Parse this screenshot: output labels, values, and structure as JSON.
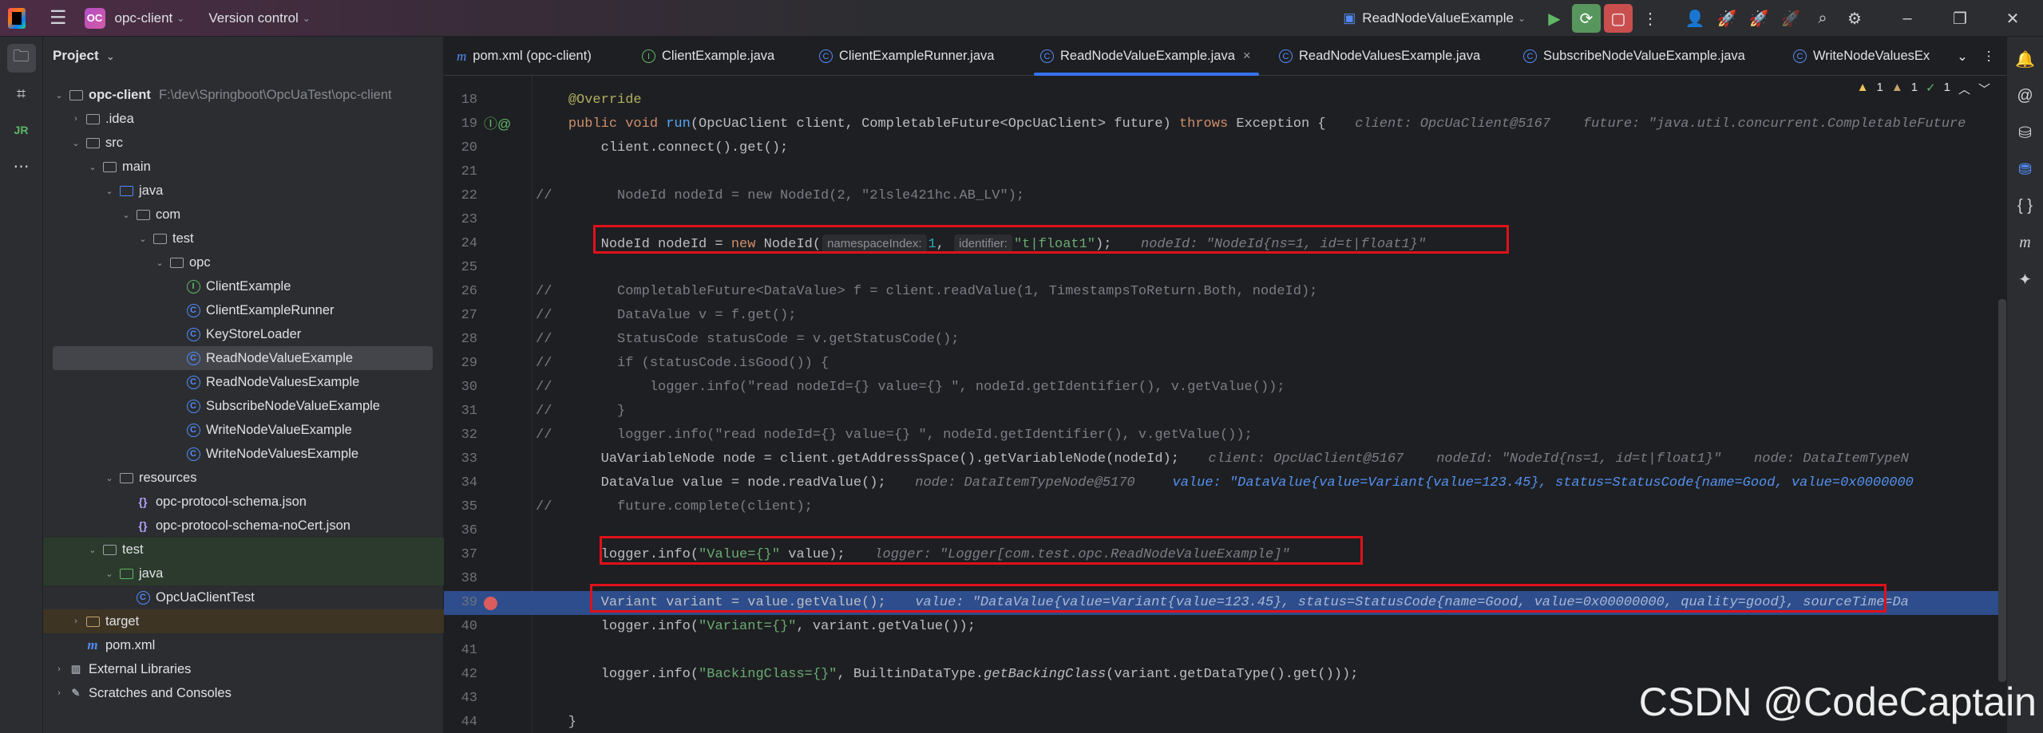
{
  "titlebar": {
    "project_badge": "OC",
    "project_name": "opc-client",
    "vcs_label": "Version control",
    "run_config": "ReadNodeValueExample"
  },
  "colors": {
    "accent": "#3574f0",
    "run_green": "#57965c",
    "stop_red": "#c94f4f",
    "highlight_line": "#2d4d8c",
    "annotation_box": "#e0111a"
  },
  "project_panel": {
    "title": "Project",
    "tree": [
      {
        "label": "opc-client",
        "path": "F:\\dev\\Springboot\\OpcUaTest\\opc-client",
        "level": 0,
        "icon": "module-folder",
        "expanded": true,
        "bold": true
      },
      {
        "label": ".idea",
        "level": 1,
        "icon": "folder",
        "expanded": false
      },
      {
        "label": "src",
        "level": 1,
        "icon": "folder",
        "expanded": true
      },
      {
        "label": "main",
        "level": 2,
        "icon": "folder",
        "expanded": true
      },
      {
        "label": "java",
        "level": 3,
        "icon": "source-folder",
        "expanded": true
      },
      {
        "label": "com",
        "level": 4,
        "icon": "package",
        "expanded": true
      },
      {
        "label": "test",
        "level": 5,
        "icon": "package",
        "expanded": true
      },
      {
        "label": "opc",
        "level": 6,
        "icon": "package",
        "expanded": true
      },
      {
        "label": "ClientExample",
        "level": 7,
        "icon": "interface"
      },
      {
        "label": "ClientExampleRunner",
        "level": 7,
        "icon": "class"
      },
      {
        "label": "KeyStoreLoader",
        "level": 7,
        "icon": "class"
      },
      {
        "label": "ReadNodeValueExample",
        "level": 7,
        "icon": "class",
        "selected": true
      },
      {
        "label": "ReadNodeValuesExample",
        "level": 7,
        "icon": "class"
      },
      {
        "label": "SubscribeNodeValueExample",
        "level": 7,
        "icon": "class"
      },
      {
        "label": "WriteNodeValueExample",
        "level": 7,
        "icon": "class"
      },
      {
        "label": "WriteNodeValuesExample",
        "level": 7,
        "icon": "class"
      },
      {
        "label": "resources",
        "level": 3,
        "icon": "resources-folder",
        "expanded": true
      },
      {
        "label": "opc-protocol-schema.json",
        "level": 4,
        "icon": "json"
      },
      {
        "label": "opc-protocol-schema-noCert.json",
        "level": 4,
        "icon": "json"
      },
      {
        "label": "test",
        "level": 2,
        "icon": "folder",
        "expanded": true,
        "tint": "green"
      },
      {
        "label": "java",
        "level": 3,
        "icon": "test-folder",
        "expanded": true,
        "tint": "green"
      },
      {
        "label": "OpcUaClientTest",
        "level": 4,
        "icon": "class"
      },
      {
        "label": "target",
        "level": 1,
        "icon": "excluded-folder",
        "expanded": false,
        "tint": "brown"
      },
      {
        "label": "pom.xml",
        "level": 1,
        "icon": "maven"
      },
      {
        "label": "External Libraries",
        "level": 0,
        "icon": "libraries",
        "expanded": false
      },
      {
        "label": "Scratches and Consoles",
        "level": 0,
        "icon": "scratches",
        "expanded": false
      }
    ]
  },
  "tabs": [
    {
      "label": "pom.xml (opc-client)",
      "icon": "maven"
    },
    {
      "label": "ClientExample.java",
      "icon": "interface"
    },
    {
      "label": "ClientExampleRunner.java",
      "icon": "class"
    },
    {
      "label": "ReadNodeValueExample.java",
      "icon": "class",
      "active": true
    },
    {
      "label": "ReadNodeValuesExample.java",
      "icon": "class"
    },
    {
      "label": "SubscribeNodeValueExample.java",
      "icon": "class"
    },
    {
      "label": "WriteNodeValuesEx",
      "icon": "class"
    }
  ],
  "inspections": {
    "warnings": "1",
    "weak_warnings": "1",
    "ok": "1"
  },
  "code": [
    {
      "n": "18",
      "t": [
        [
          "    ",
          ""
        ],
        [
          "@Override",
          "ann"
        ]
      ]
    },
    {
      "n": "19",
      "t": [
        [
          "    ",
          ""
        ],
        [
          "public void ",
          "kw"
        ],
        [
          "run",
          "fn"
        ],
        [
          "(OpcUaClient client, CompletableFuture<OpcUaClient> future) ",
          ""
        ],
        [
          "throws ",
          "kw"
        ],
        [
          "Exception {",
          ""
        ],
        [
          "   client: OpcUaClient@5167    future: \"java.util.concurrent.CompletableFuture",
          "hint"
        ]
      ]
    },
    {
      "n": "20",
      "t": [
        [
          "        client.connect().get();",
          ""
        ]
      ]
    },
    {
      "n": "21",
      "t": []
    },
    {
      "n": "22",
      "t": [
        [
          "//        NodeId nodeId = new NodeId(2, \"2lsle421hc.AB_LV\");",
          "cm"
        ]
      ]
    },
    {
      "n": "23",
      "t": []
    },
    {
      "n": "24",
      "t": [
        [
          "        NodeId nodeId = ",
          ""
        ],
        [
          "new ",
          "kw"
        ],
        [
          "NodeId(",
          ""
        ],
        [
          "namespaceIndex:",
          "ph"
        ],
        [
          "1",
          "num"
        ],
        [
          ", ",
          ""
        ],
        [
          "identifier:",
          "ph"
        ],
        [
          "\"t|float1\"",
          "str"
        ],
        [
          ");",
          ""
        ],
        [
          "   nodeId: \"NodeId{ns=1, id=t|float1}\"",
          "hint"
        ]
      ]
    },
    {
      "n": "25",
      "t": []
    },
    {
      "n": "26",
      "t": [
        [
          "//        CompletableFuture<DataValue> f = client.readValue(1, TimestampsToReturn.Both, nodeId);",
          "cm"
        ]
      ]
    },
    {
      "n": "27",
      "t": [
        [
          "//        DataValue v = f.get();",
          "cm"
        ]
      ]
    },
    {
      "n": "28",
      "t": [
        [
          "//        StatusCode statusCode = v.getStatusCode();",
          "cm"
        ]
      ]
    },
    {
      "n": "29",
      "t": [
        [
          "//        if (statusCode.isGood()) {",
          "cm"
        ]
      ]
    },
    {
      "n": "30",
      "t": [
        [
          "//            logger.info(\"read nodeId={} value={} \", nodeId.getIdentifier(), v.getValue());",
          "cm"
        ]
      ]
    },
    {
      "n": "31",
      "t": [
        [
          "//        }",
          "cm"
        ]
      ]
    },
    {
      "n": "32",
      "t": [
        [
          "//        logger.info(\"read nodeId={} value={} \", nodeId.getIdentifier(), v.getValue());",
          "cm"
        ]
      ]
    },
    {
      "n": "33",
      "t": [
        [
          "        UaVariableNode node = client.getAddressSpace().getVariableNode(nodeId);",
          ""
        ],
        [
          "   client: OpcUaClient@5167    nodeId: \"NodeId{ns=1, id=t|float1}\"    node: DataItemTypeN",
          "hint"
        ]
      ]
    },
    {
      "n": "34",
      "t": [
        [
          "        DataValue value = node.readValue();",
          ""
        ],
        [
          "   node: DataItemTypeNode@5170    ",
          "hint"
        ],
        [
          "value: \"DataValue{value=Variant{value=123.45}, status=StatusCode{name=Good, value=0x0000000",
          "dval"
        ]
      ]
    },
    {
      "n": "35",
      "t": [
        [
          "//        future.complete(client);",
          "cm"
        ]
      ]
    },
    {
      "n": "36",
      "t": []
    },
    {
      "n": "37",
      "t": [
        [
          "        logger",
          ""
        ],
        [
          ".info(\"Value={}\", value);",
          "mix37"
        ],
        [
          "   logger: \"Logger[com.test.opc.ReadNodeValueExample]\"",
          "hint"
        ]
      ]
    },
    {
      "n": "38",
      "t": []
    },
    {
      "n": "39",
      "t": [
        [
          "        Variant variant = value.getValue();",
          ""
        ],
        [
          "   value: \"DataValue{value=Variant{value=123.45}, status=StatusCode{name=Good, value=0x00000000, quality=good}, sourceTime=Da",
          "dval"
        ]
      ],
      "highlight": true,
      "breakpoint": true
    },
    {
      "n": "40",
      "t": [
        [
          "        logger.info(",
          ""
        ],
        [
          "\"Variant={}\"",
          "str"
        ],
        [
          ", variant.getValue());",
          ""
        ]
      ]
    },
    {
      "n": "41",
      "t": []
    },
    {
      "n": "42",
      "t": [
        [
          "        logger.info(",
          ""
        ],
        [
          "\"BackingClass={}\"",
          "str"
        ],
        [
          ", BuiltinDataType.",
          ""
        ],
        [
          "getBackingClass",
          "st"
        ],
        [
          "(variant.getDataType().get()));",
          ""
        ]
      ]
    },
    {
      "n": "43",
      "t": []
    },
    {
      "n": "44",
      "t": [
        [
          "    }",
          ""
        ]
      ]
    }
  ],
  "watermark": "CSDN @CodeCaptain"
}
